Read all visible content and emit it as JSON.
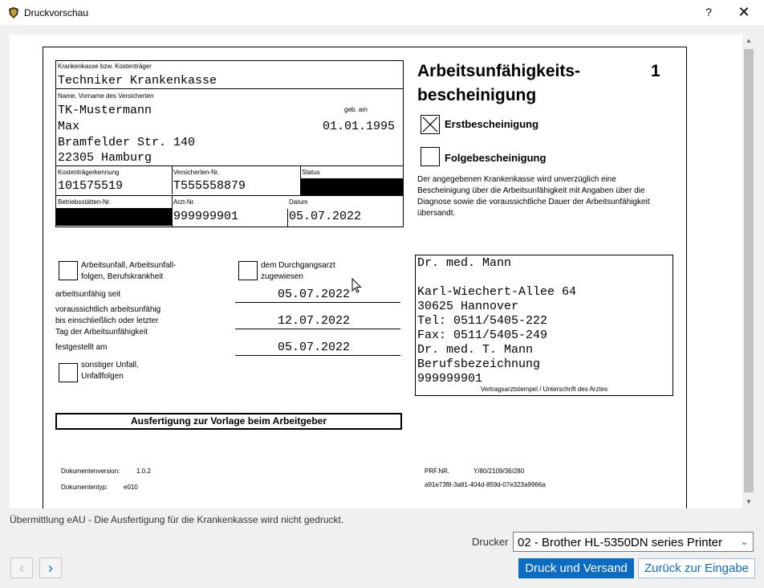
{
  "window": {
    "title": "Druckvorschau",
    "help_label": "?",
    "close_label": "✕",
    "app_icon": "shield-icon"
  },
  "form": {
    "kasse_label": "Krankenkasse bzw. Kostenträger",
    "kasse_value": "Techniker Krankenkasse",
    "name_label": "Name, Vorname des Versicherten",
    "name_line1": "TK-Mustermann",
    "name_line2": "Max",
    "address_line1": "Bramfelder Str. 140",
    "address_line2": "22305 Hamburg",
    "gebam_label": "geb. am",
    "gebam_value": "01.01.1995",
    "kt_kennung_label": "Kostenträgerkennung",
    "kt_kennung_value": "101575519",
    "versnr_label": "Versicherten-Nr.",
    "versnr_value": "T555558879",
    "status_label": "Status",
    "bsnr_label": "Betriebsstätten-Nr.",
    "arztnr_label": "Arzt-Nr.",
    "arztnr_value": "999999901",
    "datum_label": "Datum",
    "datum_value": "05.07.2022",
    "title_line1": "Arbeitsunfähigkeits-",
    "title_line2": "bescheinigung",
    "page_number": "1",
    "erst_label": "Erstbescheinigung",
    "folge_label": "Folgebescheinigung",
    "info_text": "Der angegebenen Krankenkasse wird unverzüglich eine Bescheinigung über die Arbeitsunfähigkeit mit Angaben über die Diagnose sowie die voraussichtliche Dauer der Arbeitsunfähigkeit übersandt.",
    "unfall_line1": "Arbeitsunfall, Arbeitsunfall-",
    "unfall_line2": "folgen, Berufskrankheit",
    "durchgang_line1": "dem Durchgangsarzt",
    "durchgang_line2": "zugewiesen",
    "au_seit_label": "arbeitsunfähig seit",
    "au_seit_value": "05.07.2022",
    "bis_line1": "voraussichtlich arbeitsunfähig",
    "bis_line2": "bis einschließlich oder letzter",
    "bis_line3": "Tag der Arbeitsunfähigkeit",
    "bis_value": "12.07.2022",
    "festgestellt_label": "festgestellt am",
    "festgestellt_value": "05.07.2022",
    "sonstiger_line1": "sonstiger Unfall,",
    "sonstiger_line2": "Unfallfolgen",
    "stamp_lines": [
      "Dr. med. Mann",
      "",
      "Karl-Wiechert-Allee 64",
      "30625 Hannover",
      "Tel: 0511/5405-222",
      "Fax: 0511/5405-249",
      "Dr. med. T. Mann",
      "Berufsbezeichnung",
      "999999901"
    ],
    "stamp_caption": "Vertragsarztstempel / Unterschrift des Arztes",
    "ausfertigung": "Ausfertigung zur Vorlage beim Arbeitgeber",
    "docversion_label": "Dokumentenversion:",
    "docversion_value": "1.0.2",
    "doctyp_label": "Dokumententyp:",
    "doctyp_value": "e010",
    "prfnr_label": "PRF.NR.",
    "prfnr_value": "Y/80/2109/36/280",
    "uuid": "a91e73f8-3a81-404d-859d-07e323a9966a"
  },
  "footer": {
    "status_message": "Übermittlung eAU - Die Ausfertigung für die Krankenkasse wird nicht gedruckt.",
    "printer_label": "Drucker",
    "printer_value": "02 - Brother HL-5350DN series Printer",
    "prev_icon": "chevron-left-icon",
    "next_icon": "chevron-right-icon",
    "print_send_label": "Druck und Versand",
    "back_label": "Zurück zur Eingabe"
  }
}
